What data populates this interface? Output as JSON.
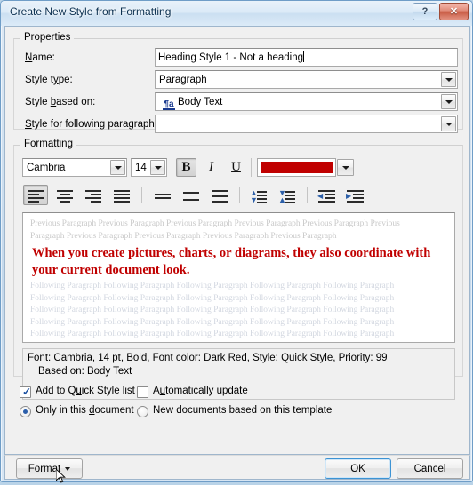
{
  "window": {
    "title": "Create New Style from Formatting",
    "help_button": "?",
    "close_button": "✕"
  },
  "properties": {
    "group_label": "Properties",
    "fields": [
      {
        "label_pre": "",
        "label_key": "N",
        "label_post": "ame:",
        "value": "Heading Style 1 - Not a heading",
        "type": "textbox"
      },
      {
        "label_pre": "Style t",
        "label_key": "y",
        "label_post": "pe:",
        "value": "Paragraph",
        "type": "combo"
      },
      {
        "label_pre": "Style ",
        "label_key": "b",
        "label_post": "ased on:",
        "value": "Body Text",
        "icon": "paragraph-style-icon",
        "icon_text": "¶a",
        "type": "combo"
      },
      {
        "label_pre": "",
        "label_key": "S",
        "label_post": "tyle for following paragraph:",
        "value": "",
        "type": "combo"
      }
    ]
  },
  "formatting": {
    "group_label": "Formatting",
    "font_name": "Cambria",
    "font_size": "14",
    "bold_label": "B",
    "italic_label": "I",
    "underline_label": "U",
    "font_color": "#C00000",
    "font_color_name": "Dark Red",
    "bold_active": true,
    "align_active": "left",
    "buttons": [
      {
        "name": "align-left-button",
        "pressed": true
      },
      {
        "name": "align-center-button",
        "pressed": false
      },
      {
        "name": "align-right-button",
        "pressed": false
      },
      {
        "name": "align-justify-button",
        "pressed": false
      },
      {
        "name": "line-spacing-single-button",
        "pressed": false
      },
      {
        "name": "line-spacing-1-5-button",
        "pressed": false
      },
      {
        "name": "line-spacing-double-button",
        "pressed": false
      },
      {
        "name": "decrease-paragraph-spacing-button",
        "pressed": false
      },
      {
        "name": "increase-paragraph-spacing-button",
        "pressed": false
      },
      {
        "name": "decrease-indent-button",
        "pressed": false
      },
      {
        "name": "increase-indent-button",
        "pressed": false
      }
    ]
  },
  "preview": {
    "previous_line_1": "Previous Paragraph Previous Paragraph Previous Paragraph Previous Paragraph Previous Paragraph Previous",
    "previous_line_2": "Paragraph Previous Paragraph Previous Paragraph Previous Paragraph Previous Paragraph",
    "sample_text": "When you create pictures, charts, or diagrams, they also coordinate with your current document look.",
    "following_line": "Following Paragraph Following Paragraph Following Paragraph Following Paragraph Following Paragraph"
  },
  "description": {
    "line1": "Font: Cambria, 14 pt, Bold, Font color: Dark Red, Style: Quick Style, Priority: 99",
    "line2": "Based on: Body Text"
  },
  "options": {
    "add_to_quick_style": {
      "label_pre": "Add to Q",
      "label_key": "u",
      "label_post": "ick Style list",
      "checked": true
    },
    "automatically_update": {
      "label_pre": "A",
      "label_key": "u",
      "label_post": "tomatically update",
      "checked": false
    },
    "only_this_document": {
      "label_pre": "Only in this ",
      "label_key": "d",
      "label_post": "ocument",
      "selected": true
    },
    "new_documents": {
      "label_pre": "New documents based on this template",
      "label_key": "",
      "label_post": "",
      "selected": false
    }
  },
  "footer": {
    "format_pre": "Fo",
    "format_key": "r",
    "format_post": "mat",
    "ok_label": "OK",
    "cancel_label": "Cancel"
  }
}
